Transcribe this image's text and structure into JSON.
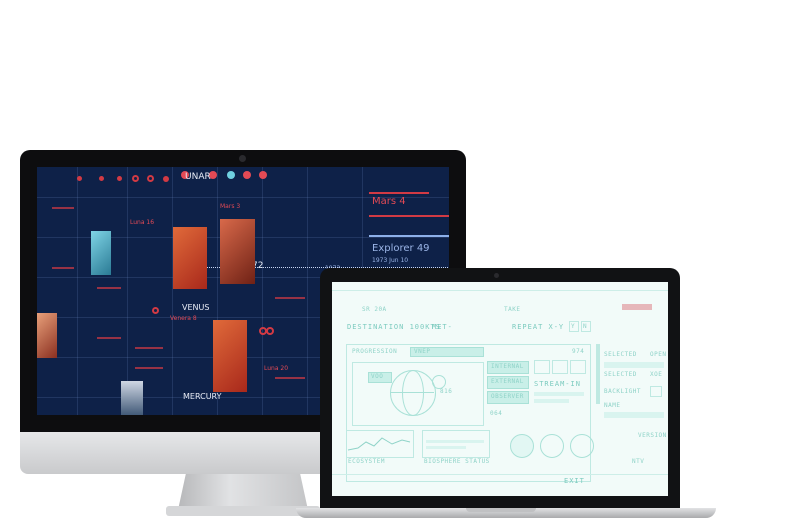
{
  "imac": {
    "header_label": "UNAR",
    "mars4_title": "Mars 4",
    "explorer_title": "Explorer 49",
    "explorer_date": "1973 Jun 10",
    "venus_label": "VENUS",
    "mercury_label": "MERCURY",
    "luna_label": "Luna 20",
    "value_72": "72",
    "value_1973": "1973",
    "mars3_label": "Mars 3",
    "luna_left": "Luna 16",
    "venera_label": "Venera 8"
  },
  "macbook": {
    "top_labels": [
      "SR 20A",
      "TAKE"
    ],
    "destination": "DESTINATION 100KTS",
    "destination_suffix": "MET-",
    "repeat": "REPEAT X-Y",
    "repeat_y": "Y",
    "repeat_n": "N",
    "progression": "PROGRESSION",
    "select_value": "VNEP",
    "col_value": "974",
    "voo": "VOO",
    "buttons": [
      "INTERNAL",
      "EXTERNAL",
      "OBSERVER"
    ],
    "stream": "STREAM-IN",
    "side_items": [
      "SELECTED",
      "SELECTED",
      "BACKLIGHT",
      "NAME"
    ],
    "side_values": [
      "OPEN",
      "XOE"
    ],
    "ecosystem": "ECOSYSTEM",
    "biosphere": "BIOSPHERE STATUS",
    "exit": "EXIT",
    "number_064": "064",
    "number_816": "816",
    "version": "VERSION",
    "ntv_label": "NTV"
  },
  "colors": {
    "imac_bg": "#0e2148",
    "accent_red": "#d23a44",
    "mint": "#8fd3c8"
  }
}
